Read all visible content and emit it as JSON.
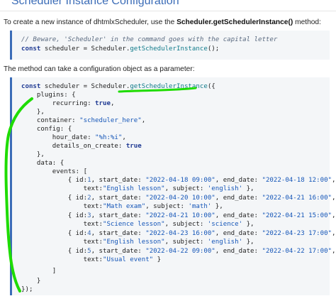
{
  "page": {
    "title": "Scheduler Instance Configuration",
    "intro_prefix": "To create a new instance of dhtmlxScheduler, use the ",
    "intro_method": "Scheduler.getSchedulerInstance()",
    "intro_suffix": " method:",
    "param_text": "The method can take a configuration object as a parameter:"
  },
  "code1": {
    "comment": "// Beware, 'Scheduler' in the command goes with the capital letter",
    "line2_prefix": "const",
    "line2_mid": " scheduler = Scheduler.",
    "line2_method": "getSchedulerInstance",
    "line2_suffix": "();"
  },
  "code2": {
    "l1_kw": "const",
    "l1_mid": " scheduler = Scheduler.",
    "l1_method": "getSchedulerInstance",
    "l1_end": "({",
    "l2": "    plugins: {",
    "l3_pre": "        recurring: ",
    "l3_val": "true",
    "l3_post": ",",
    "l4": "    },",
    "l5_pre": "    container: ",
    "l5_val": "\"scheduler_here\"",
    "l5_post": ",",
    "l6": "    config: {",
    "l7_pre": "        hour_date: ",
    "l7_val": "\"%h:%i\"",
    "l7_post": ",",
    "l8_pre": "        details_on_create: ",
    "l8_val": "true",
    "l9": "    },",
    "l10": "    data: {",
    "l11": "        events: [",
    "events": [
      {
        "id": "1",
        "start": "\"2022-04-18 09:00\"",
        "end": "\"2022-04-18 12:00\"",
        "text": "\"English lesson\"",
        "subject": "'english'"
      },
      {
        "id": "2",
        "start": "\"2022-04-20 10:00\"",
        "end": "\"2022-04-21 16:00\"",
        "text": "\"Math exam\"",
        "subject": "'math'"
      },
      {
        "id": "3",
        "start": "\"2022-04-21 10:00\"",
        "end": "\"2022-04-21 15:00\"",
        "text": "\"Science lesson\"",
        "subject": "'science'"
      },
      {
        "id": "4",
        "start": "\"2022-04-23 16:00\"",
        "end": "\"2022-04-23 17:00\"",
        "text": "\"English lesson\"",
        "subject": "'english'"
      },
      {
        "id": "5",
        "start": "\"2022-04-22 09:00\"",
        "end": "\"2022-04-22 17:00\"",
        "text": "\"Usual event\"",
        "subject": ""
      }
    ],
    "l_close_events": "        ]",
    "l_close_data": "    }",
    "l_close_all": "});"
  },
  "annotation": {
    "stroke_color": "#1edc00"
  }
}
